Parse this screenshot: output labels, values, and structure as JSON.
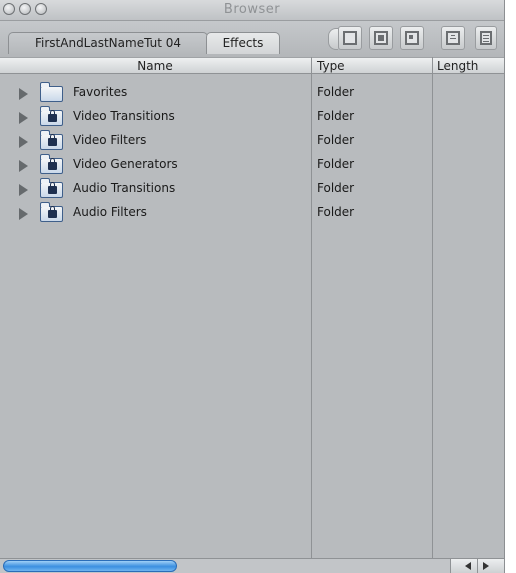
{
  "window": {
    "title": "Browser"
  },
  "tabs": [
    {
      "label": "FirstAndLastNameTut 04",
      "active": false
    },
    {
      "label": "Effects",
      "active": true
    }
  ],
  "view_buttons": [
    {
      "icon": "view-large-icon"
    },
    {
      "icon": "view-medium-icon"
    },
    {
      "icon": "view-small-icon"
    },
    {
      "icon": "view-text-icon"
    },
    {
      "icon": "view-list-icon"
    }
  ],
  "columns": {
    "name": "Name",
    "type": "Type",
    "length": "Length"
  },
  "rows": [
    {
      "name": "Favorites",
      "type": "Folder",
      "locked": false
    },
    {
      "name": "Video Transitions",
      "type": "Folder",
      "locked": true
    },
    {
      "name": "Video Filters",
      "type": "Folder",
      "locked": true
    },
    {
      "name": "Video Generators",
      "type": "Folder",
      "locked": true
    },
    {
      "name": "Audio Transitions",
      "type": "Folder",
      "locked": true
    },
    {
      "name": "Audio Filters",
      "type": "Folder",
      "locked": true
    }
  ],
  "colors": {
    "list_background": "#b8bbbe",
    "scroll_thumb": "#3b8fe0",
    "folder_outline": "#3f5f8a"
  }
}
